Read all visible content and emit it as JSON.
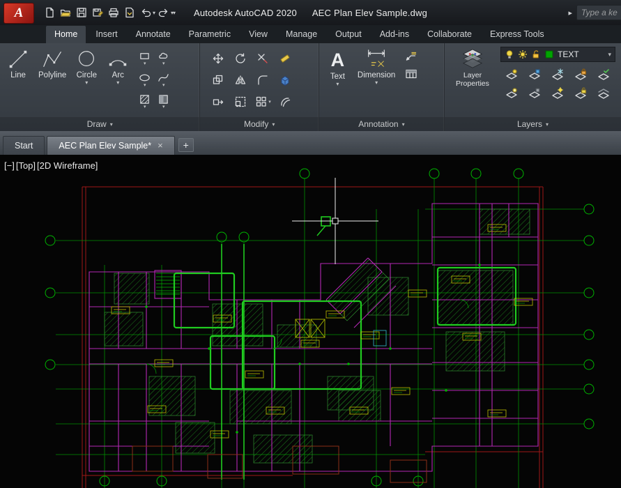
{
  "title_bar": {
    "app_title": "Autodesk AutoCAD 2020",
    "document_title": "AEC Plan Elev Sample.dwg",
    "search_placeholder": "Type a ke"
  },
  "icons": {
    "logo_glyph": "A",
    "text_glyph": "A",
    "caret": "▾",
    "arrow_right": "▸",
    "plus": "+",
    "close": "×"
  },
  "ribbon": {
    "tabs": [
      {
        "label": "Home",
        "active": true
      },
      {
        "label": "Insert",
        "active": false
      },
      {
        "label": "Annotate",
        "active": false
      },
      {
        "label": "Parametric",
        "active": false
      },
      {
        "label": "View",
        "active": false
      },
      {
        "label": "Manage",
        "active": false
      },
      {
        "label": "Output",
        "active": false
      },
      {
        "label": "Add-ins",
        "active": false
      },
      {
        "label": "Collaborate",
        "active": false
      },
      {
        "label": "Express Tools",
        "active": false
      }
    ],
    "panels": {
      "draw": {
        "footer": "Draw",
        "tools": {
          "line": "Line",
          "polyline": "Polyline",
          "circle": "Circle",
          "arc": "Arc"
        }
      },
      "modify": {
        "footer": "Modify"
      },
      "annotation": {
        "footer": "Annotation",
        "tools": {
          "text": "Text",
          "dimension": "Dimension"
        }
      },
      "layers": {
        "footer": "Layers",
        "layer_properties": "Layer Properties",
        "current_layer": "TEXT"
      }
    }
  },
  "file_tabs": {
    "start": "Start",
    "document": "AEC Plan Elev Sample*"
  },
  "viewport": {
    "minimize": "[−]",
    "view": "[Top]",
    "visual_style": "[2D Wireframe]"
  },
  "colors": {
    "accent_red": "#b01818",
    "cad_green": "#00b400",
    "cad_magenta": "#b428b4",
    "cad_yellow": "#c8c800",
    "layer_swatch_green": "#00a400"
  }
}
